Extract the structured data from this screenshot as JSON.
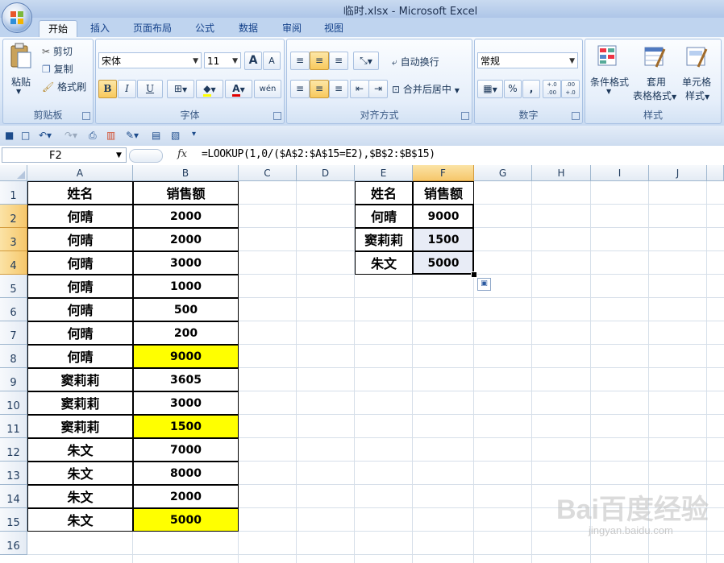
{
  "window": {
    "title": "临时.xlsx - Microsoft Excel"
  },
  "tabs": [
    "开始",
    "插入",
    "页面布局",
    "公式",
    "数据",
    "审阅",
    "视图"
  ],
  "ribbon": {
    "clipboard": {
      "label": "剪贴板",
      "paste": "粘贴",
      "cut": "剪切",
      "copy": "复制",
      "format_painter": "格式刷"
    },
    "font": {
      "label": "字体",
      "font_name": "宋体",
      "font_size": "11",
      "bold": "B",
      "italic": "I",
      "underline": "U",
      "grow": "A",
      "shrink": "A",
      "font_color": "A",
      "phonetic": "wén"
    },
    "alignment": {
      "label": "对齐方式",
      "wrap_text": "自动换行",
      "merge_center": "合并后居中"
    },
    "number": {
      "label": "数字",
      "format": "常规",
      "percent": "%",
      "comma": ",",
      "inc_decimal": "+.0 .00",
      "dec_decimal": ".00 +.0"
    },
    "styles": {
      "label": "样式",
      "conditional": "条件格式",
      "table_1": "套用",
      "table_2": "表格格式",
      "cell_1": "单元格",
      "cell_2": "样式"
    }
  },
  "formula_bar": {
    "name_box": "F2",
    "fx": "fx",
    "formula": "=LOOKUP(1,0/($A$2:$A$15=E2),$B$2:$B$15)"
  },
  "columns": [
    "A",
    "B",
    "C",
    "D",
    "E",
    "F",
    "G",
    "H",
    "I",
    "J"
  ],
  "rows": [
    "1",
    "2",
    "3",
    "4",
    "5",
    "6",
    "7",
    "8",
    "9",
    "10",
    "11",
    "12",
    "13",
    "14",
    "15",
    "16"
  ],
  "table1": {
    "header": [
      "姓名",
      "销售额"
    ],
    "rows": [
      [
        "何晴",
        "2000"
      ],
      [
        "何晴",
        "2000"
      ],
      [
        "何晴",
        "3000"
      ],
      [
        "何晴",
        "1000"
      ],
      [
        "何晴",
        "500"
      ],
      [
        "何晴",
        "200"
      ],
      [
        "何晴",
        "9000"
      ],
      [
        "窦莉莉",
        "3605"
      ],
      [
        "窦莉莉",
        "3000"
      ],
      [
        "窦莉莉",
        "1500"
      ],
      [
        "朱文",
        "7000"
      ],
      [
        "朱文",
        "8000"
      ],
      [
        "朱文",
        "2000"
      ],
      [
        "朱文",
        "5000"
      ]
    ],
    "highlighted_rows": [
      7,
      10,
      14
    ],
    "highlight_color": "#ffff00"
  },
  "table2": {
    "header": [
      "姓名",
      "销售额"
    ],
    "rows": [
      [
        "何晴",
        "9000"
      ],
      [
        "窦莉莉",
        "1500"
      ],
      [
        "朱文",
        "5000"
      ]
    ]
  },
  "selected_cell": "F2",
  "watermark": {
    "brand": "Bai百度经验",
    "url": "jingyan.baidu.com"
  }
}
